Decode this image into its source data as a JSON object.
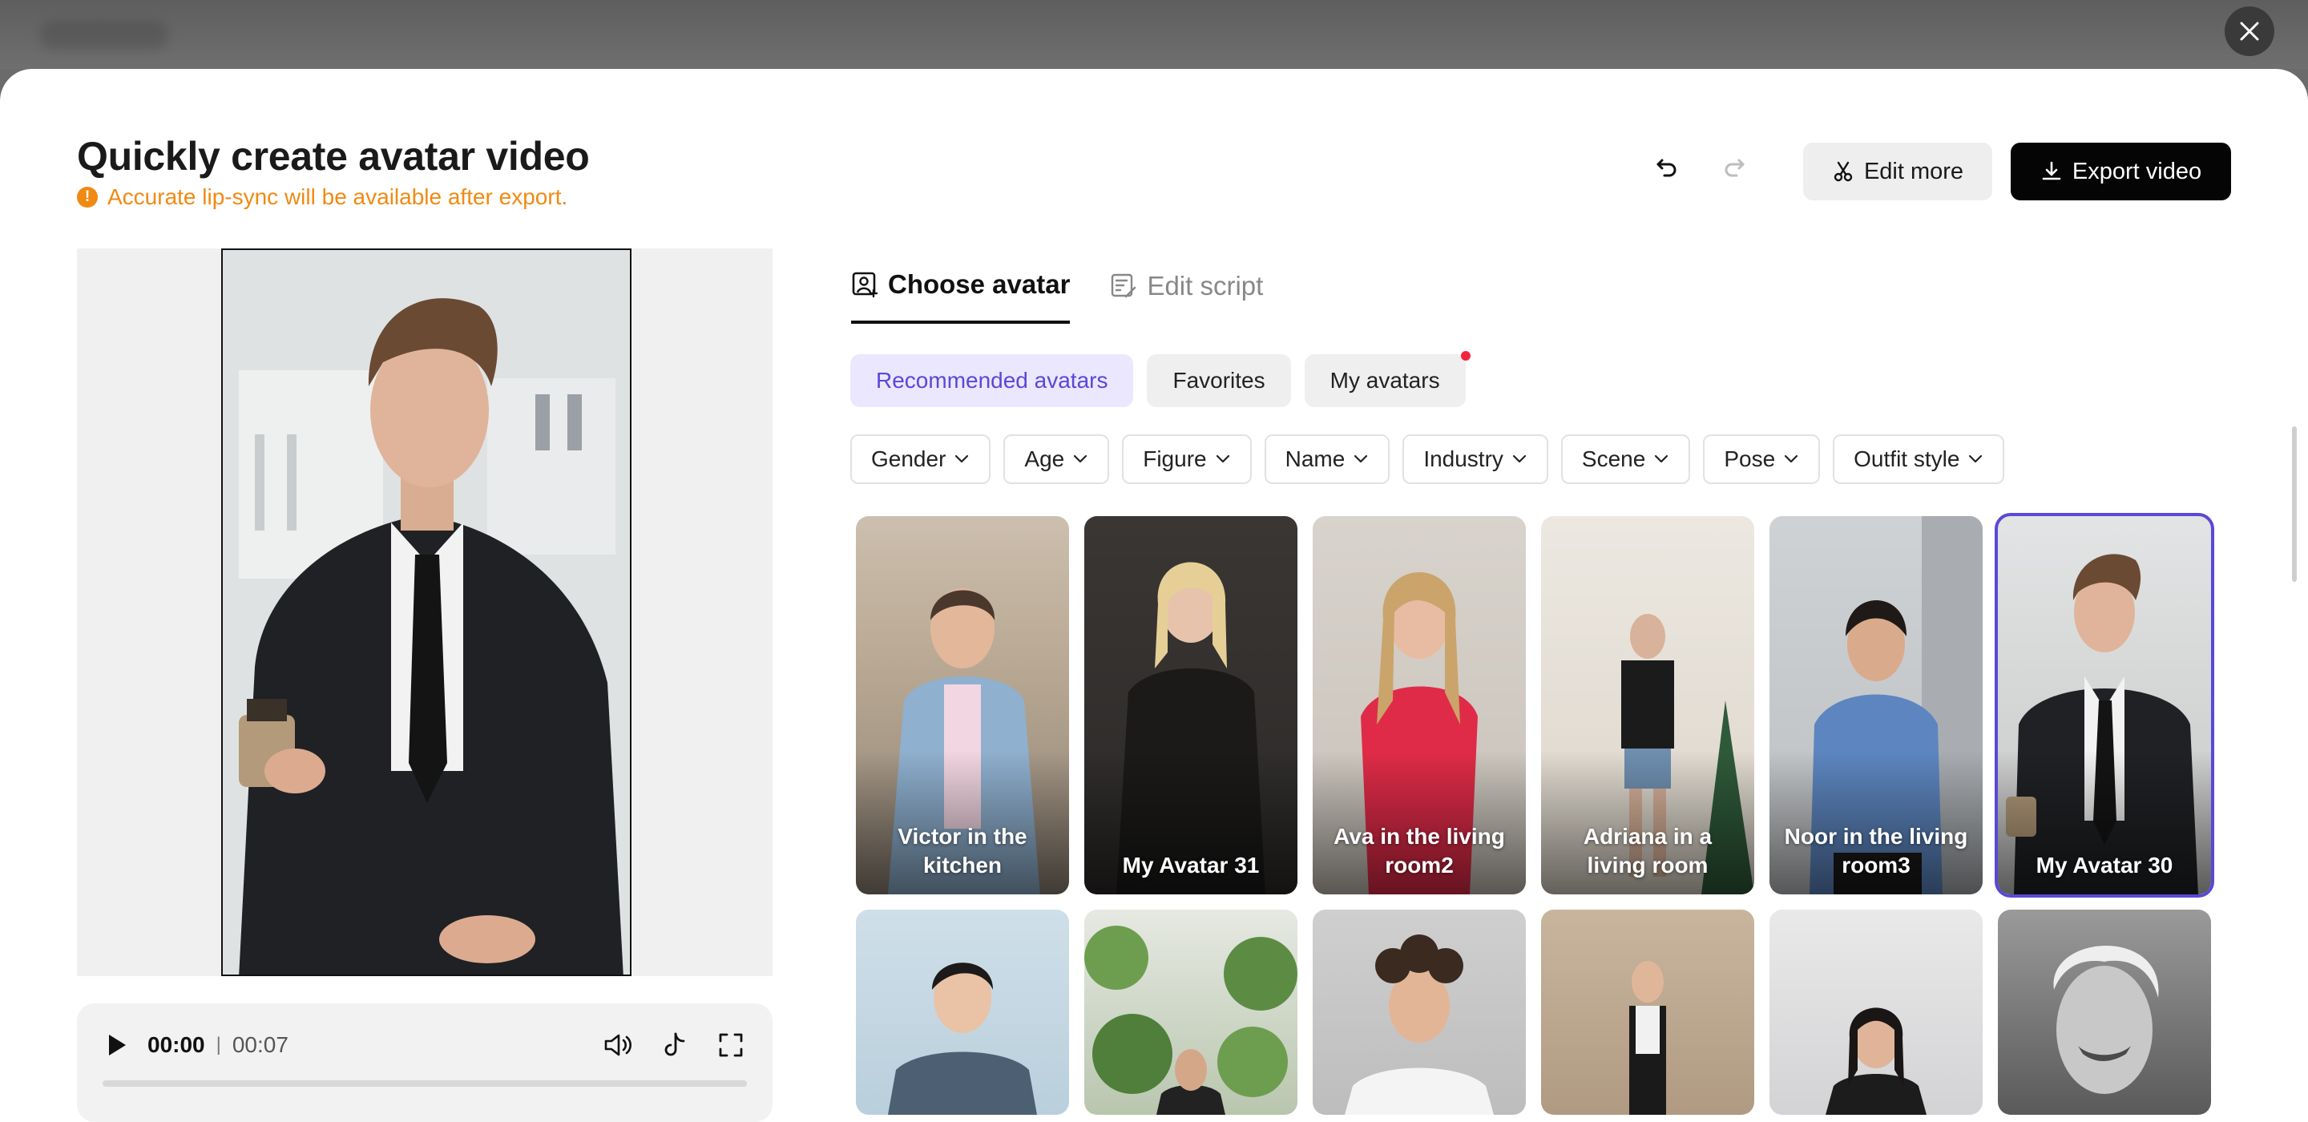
{
  "header": {
    "title": "Quickly create avatar video",
    "notice": "Accurate lip-sync will be available after export.",
    "edit_more": "Edit more",
    "export_video": "Export video"
  },
  "player": {
    "current_time": "00:00",
    "separator": "|",
    "duration": "00:07",
    "progress": 0
  },
  "tabs": [
    {
      "label": "Choose avatar",
      "active": true
    },
    {
      "label": "Edit script",
      "active": false
    }
  ],
  "categories": [
    {
      "label": "Recommended avatars",
      "active": true
    },
    {
      "label": "Favorites",
      "active": false
    },
    {
      "label": "My avatars",
      "active": false,
      "badge": true
    }
  ],
  "filters": [
    "Gender",
    "Age",
    "Figure",
    "Name",
    "Industry",
    "Scene",
    "Pose",
    "Outfit style"
  ],
  "avatars_row1": [
    {
      "label": "Victor in the kitchen"
    },
    {
      "label": "My Avatar 31"
    },
    {
      "label": "Ava in the living room2"
    },
    {
      "label": "Adriana in a living room"
    },
    {
      "label": "Noor in the living room3"
    },
    {
      "label": "My Avatar 30",
      "selected": true
    }
  ],
  "colors": {
    "accent": "#5a48d6",
    "warning": "#f08a12",
    "badge": "#f5243c"
  }
}
